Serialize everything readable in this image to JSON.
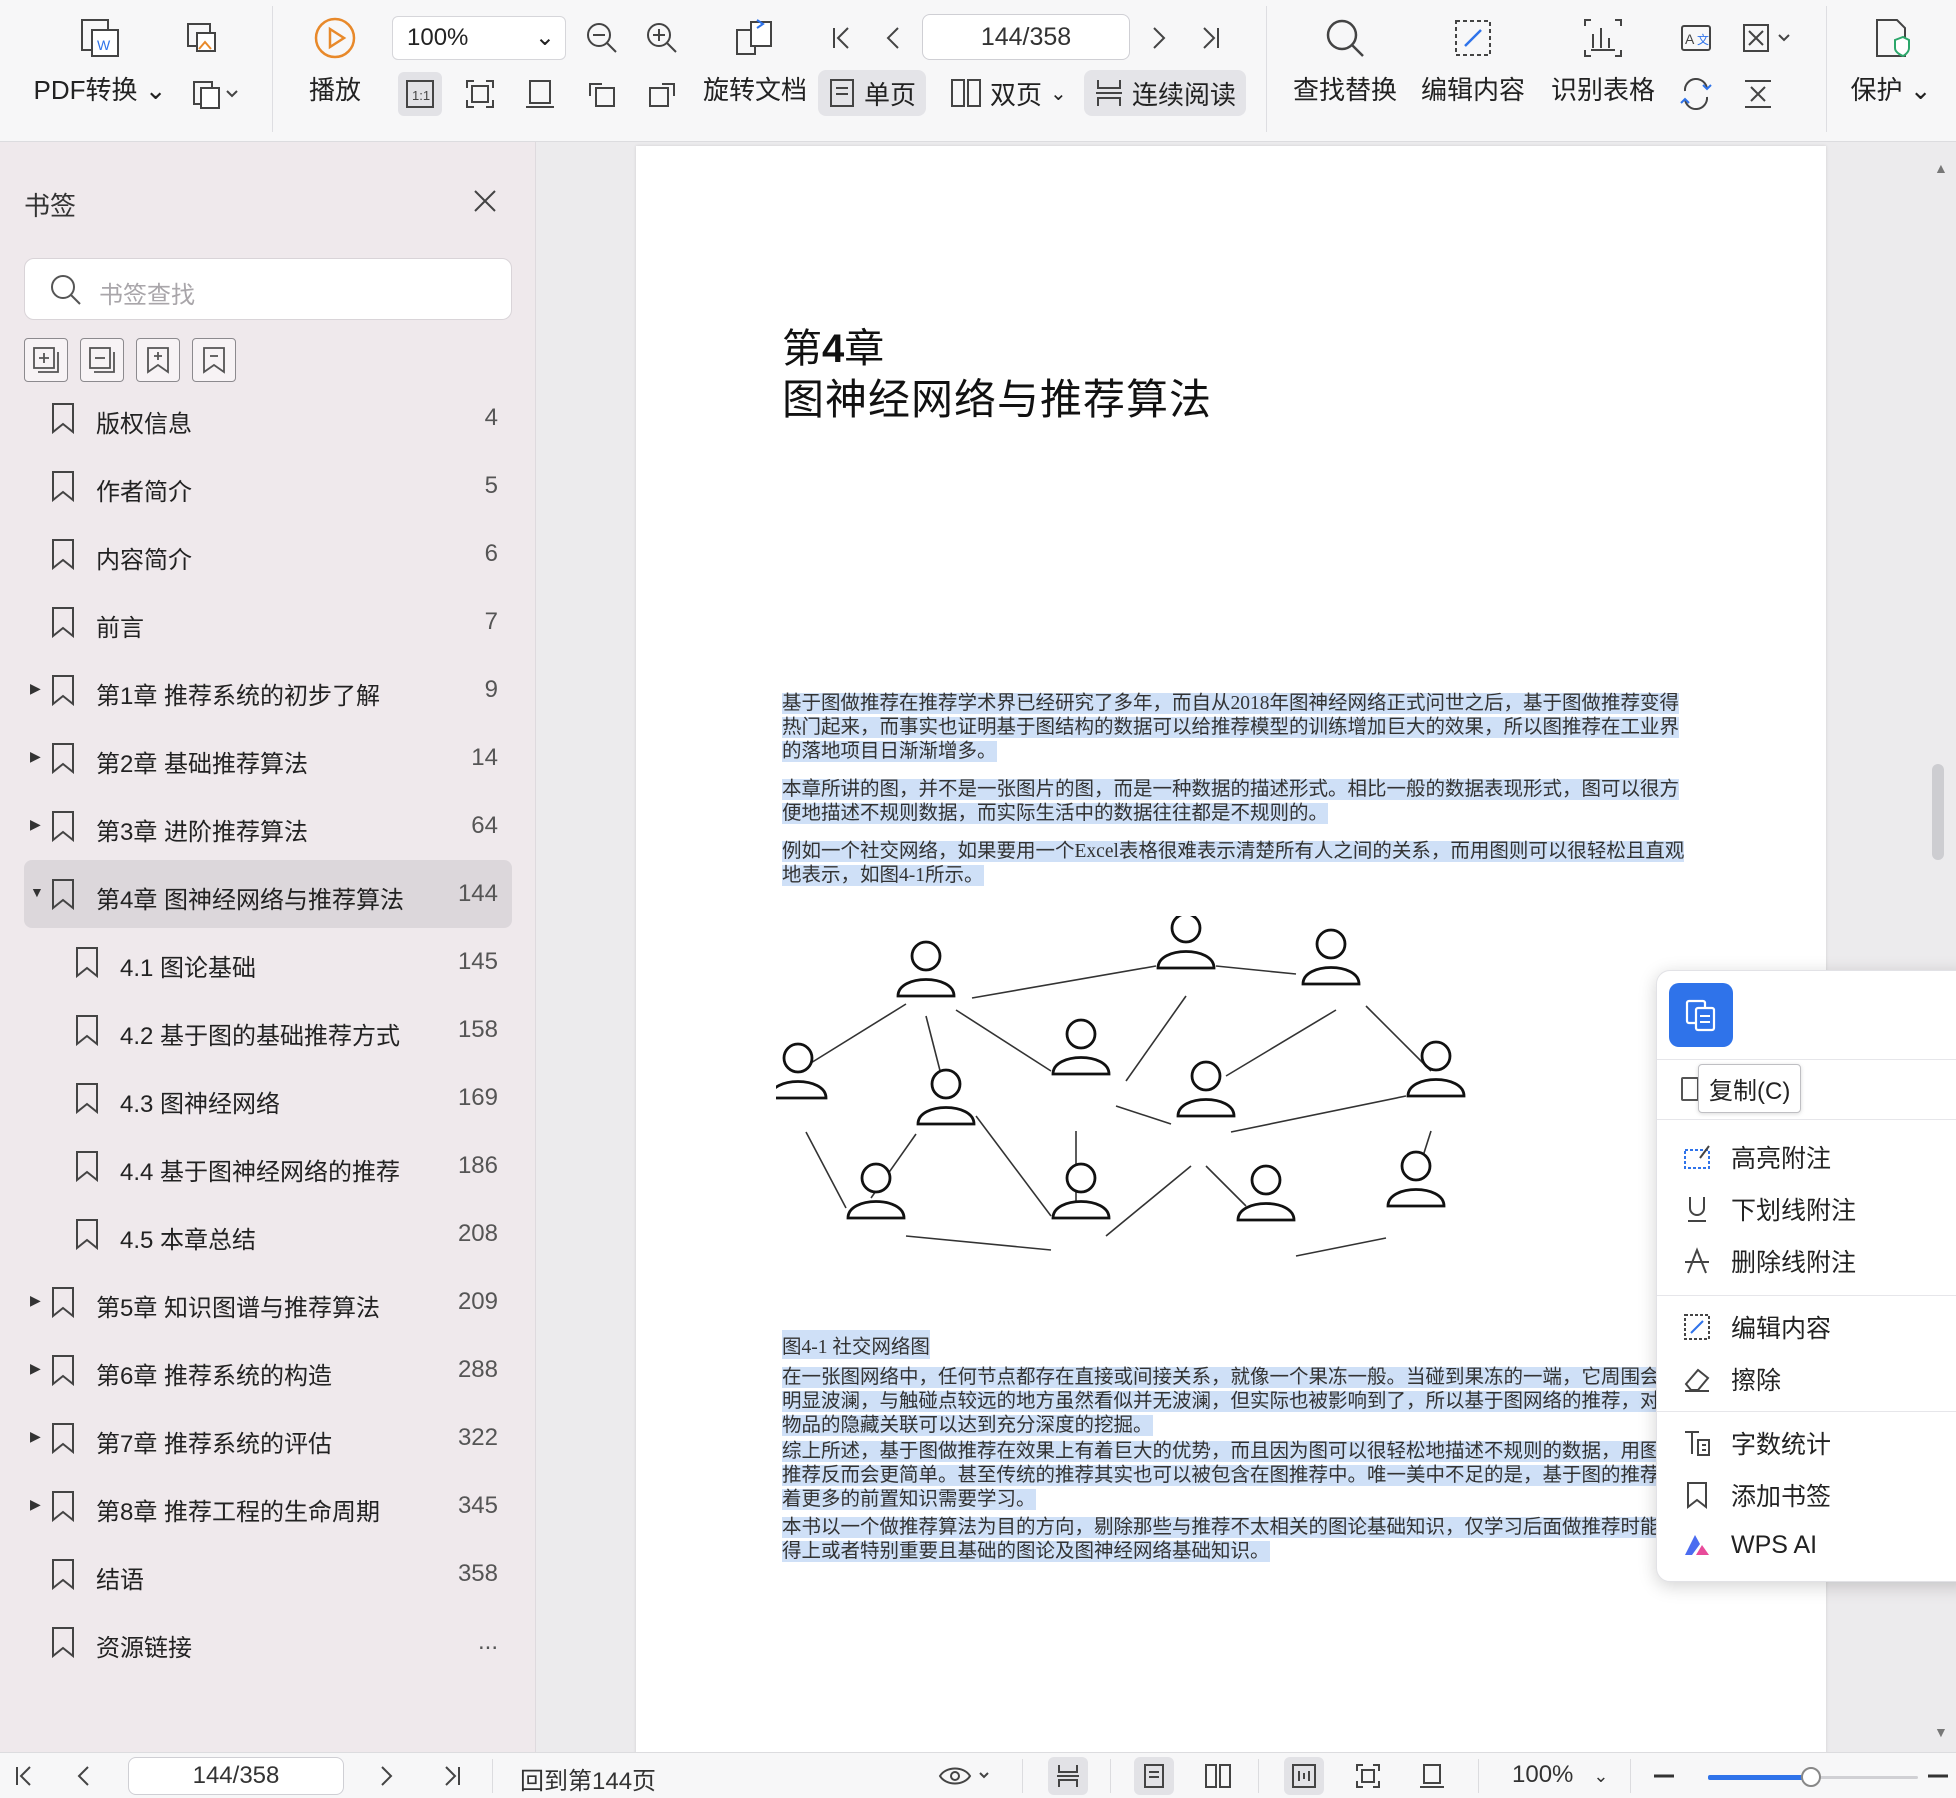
{
  "toolbar": {
    "pdf_convert": "PDF转换",
    "play": "播放",
    "zoom": "100%",
    "rotate": "旋转文档",
    "page_indicator": "144/358",
    "single_page": "单页",
    "double_page": "双页",
    "continuous": "连续阅读",
    "find_replace": "查找替换",
    "edit_content": "编辑内容",
    "recognize_table": "识别表格",
    "protect": "保护"
  },
  "sidebar": {
    "title": "书签",
    "search_placeholder": "书签查找",
    "items": [
      {
        "label": "版权信息",
        "page": "4",
        "level": 0,
        "expandable": false,
        "active": false
      },
      {
        "label": "作者简介",
        "page": "5",
        "level": 0,
        "expandable": false,
        "active": false
      },
      {
        "label": "内容简介",
        "page": "6",
        "level": 0,
        "expandable": false,
        "active": false
      },
      {
        "label": "前言",
        "page": "7",
        "level": 0,
        "expandable": false,
        "active": false
      },
      {
        "label": "第1章 推荐系统的初步了解",
        "page": "9",
        "level": 0,
        "expandable": true,
        "active": false
      },
      {
        "label": "第2章 基础推荐算法",
        "page": "14",
        "level": 0,
        "expandable": true,
        "active": false
      },
      {
        "label": "第3章 进阶推荐算法",
        "page": "64",
        "level": 0,
        "expandable": true,
        "active": false
      },
      {
        "label": "第4章 图神经网络与推荐算法",
        "page": "144",
        "level": 0,
        "expandable": true,
        "expanded": true,
        "active": true
      },
      {
        "label": "4.1 图论基础",
        "page": "145",
        "level": 1,
        "expandable": false,
        "active": false
      },
      {
        "label": "4.2 基于图的基础推荐方式",
        "page": "158",
        "level": 1,
        "expandable": false,
        "active": false
      },
      {
        "label": "4.3 图神经网络",
        "page": "169",
        "level": 1,
        "expandable": false,
        "active": false
      },
      {
        "label": "4.4 基于图神经网络的推荐",
        "page": "186",
        "level": 1,
        "expandable": false,
        "active": false
      },
      {
        "label": "4.5 本章总结",
        "page": "208",
        "level": 1,
        "expandable": false,
        "active": false
      },
      {
        "label": "第5章 知识图谱与推荐算法",
        "page": "209",
        "level": 0,
        "expandable": true,
        "active": false
      },
      {
        "label": "第6章 推荐系统的构造",
        "page": "288",
        "level": 0,
        "expandable": true,
        "active": false
      },
      {
        "label": "第7章 推荐系统的评估",
        "page": "322",
        "level": 0,
        "expandable": true,
        "active": false
      },
      {
        "label": "第8章 推荐工程的生命周期",
        "page": "345",
        "level": 0,
        "expandable": true,
        "active": false
      },
      {
        "label": "结语",
        "page": "358",
        "level": 0,
        "expandable": false,
        "active": false
      },
      {
        "label": "资源链接",
        "page": "...",
        "level": 0,
        "expandable": false,
        "active": false
      }
    ]
  },
  "document": {
    "chapter_number_prefix": "第",
    "chapter_number": "4",
    "chapter_number_suffix": "章",
    "chapter_title": "图神经网络与推荐算法",
    "paragraphs": [
      "基于图做推荐在推荐学术界已经研究了多年，而自从2018年图神经网络正式问世之后，基于图做推荐变得热门起来，而事实也证明基于图结构的数据可以给推荐模型的训练增加巨大的效果，所以图推荐在工业界的落地项目日渐渐增多。",
      "本章所讲的图，并不是一张图片的图，而是一种数据的描述形式。相比一般的数据表现形式，图可以很方便地描述不规则数据，而实际生活中的数据往往都是不规则的。",
      "例如一个社交网络，如果要用一个Excel表格很难表示清楚所有人之间的关系，而用图则可以很轻松且直观地表示，如图4-1所示。"
    ],
    "figure_caption": "图4-1 社交网络图",
    "paragraphs_after": [
      "在一张图网络中，任何节点都存在直接或间接关系，就像一个果冻一般。当碰到果冻的一端，它周围会有明显波澜，与触碰点较远的地方虽然看似并无波澜，但实际也被影响到了，所以基于图网络的推荐，对于物品的隐藏关联可以达到充分深度的挖掘。",
      "综上所述，基于图做推荐在效果上有着巨大的优势，而且因为图可以很轻松地描述不规则的数据，用图做推荐反而会更简单。甚至传统的推荐其实也可以被包含在图推荐中。唯一美中不足的是，基于图的推荐有着更多的前置知识需要学习。",
      "本书以一个做推荐算法为目的方向，剔除那些与推荐不太相关的图论基础知识，仅学习后面做推荐时能用得上或者特别重要且基础的图论及图神经网络基础知识。"
    ]
  },
  "context_menu": {
    "copy_tooltip": "复制(C)",
    "items": [
      {
        "label": "高亮附注",
        "icon": "highlight-icon"
      },
      {
        "label": "下划线附注",
        "icon": "underline-icon"
      },
      {
        "label": "删除线附注",
        "icon": "strikethrough-icon"
      },
      {
        "label": "编辑内容",
        "icon": "edit-icon"
      },
      {
        "label": "擦除",
        "icon": "eraser-icon"
      },
      {
        "label": "字数统计",
        "icon": "word-count-icon"
      },
      {
        "label": "添加书签",
        "icon": "bookmark-icon"
      },
      {
        "label": "WPS AI",
        "icon": "wps-ai-icon"
      }
    ]
  },
  "statusbar": {
    "page_indicator": "144/358",
    "goto_label": "回到第144页",
    "zoom": "100%",
    "zoom_level": 0.49
  },
  "colors": {
    "accent": "#2f73ea",
    "selection": "#cfe0f7",
    "play_icon": "#e8892a"
  }
}
